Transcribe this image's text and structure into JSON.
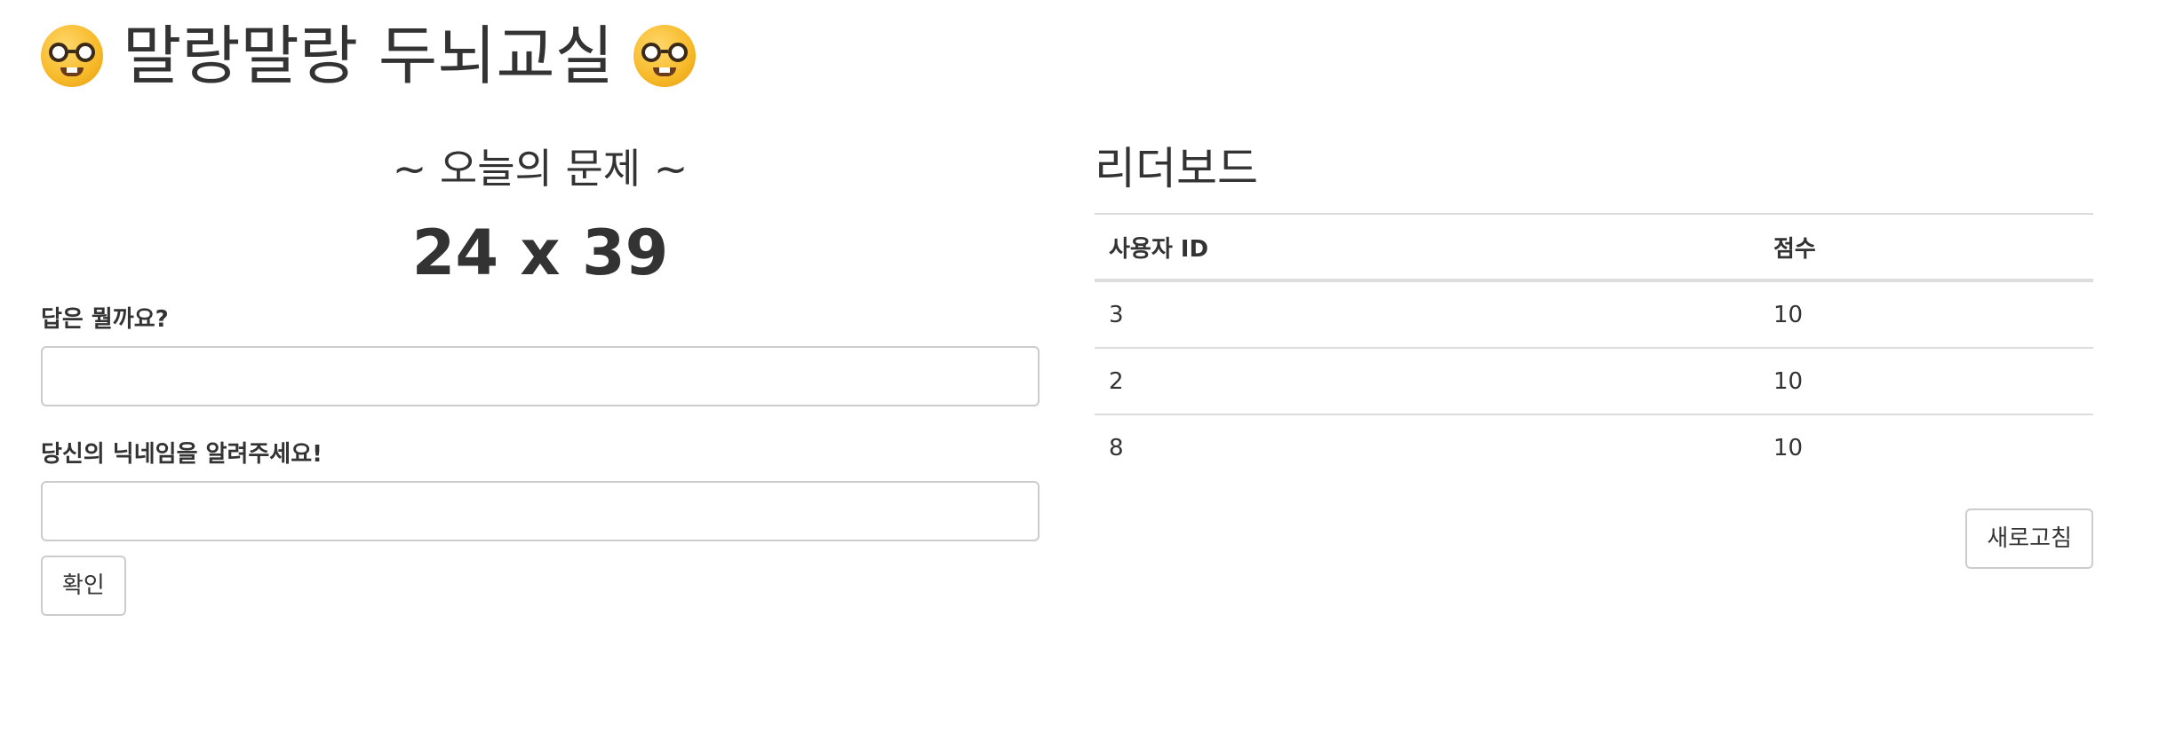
{
  "header": {
    "title": "말랑말랑 두뇌교실",
    "left_icon": "nerd-face-icon",
    "right_icon": "nerd-face-icon"
  },
  "quiz": {
    "heading": "~ 오늘의 문제 ~",
    "problem": "24 x 39",
    "answer_label": "답은 뭘까요?",
    "answer_value": "",
    "nickname_label": "당신의 닉네임을 알려주세요!",
    "nickname_value": "",
    "submit_label": "확인"
  },
  "leaderboard": {
    "heading": "리더보드",
    "columns": [
      "사용자 ID",
      "점수"
    ],
    "rows": [
      {
        "user_id": "3",
        "score": "10"
      },
      {
        "user_id": "2",
        "score": "10"
      },
      {
        "user_id": "8",
        "score": "10"
      }
    ],
    "refresh_label": "새로고침"
  }
}
